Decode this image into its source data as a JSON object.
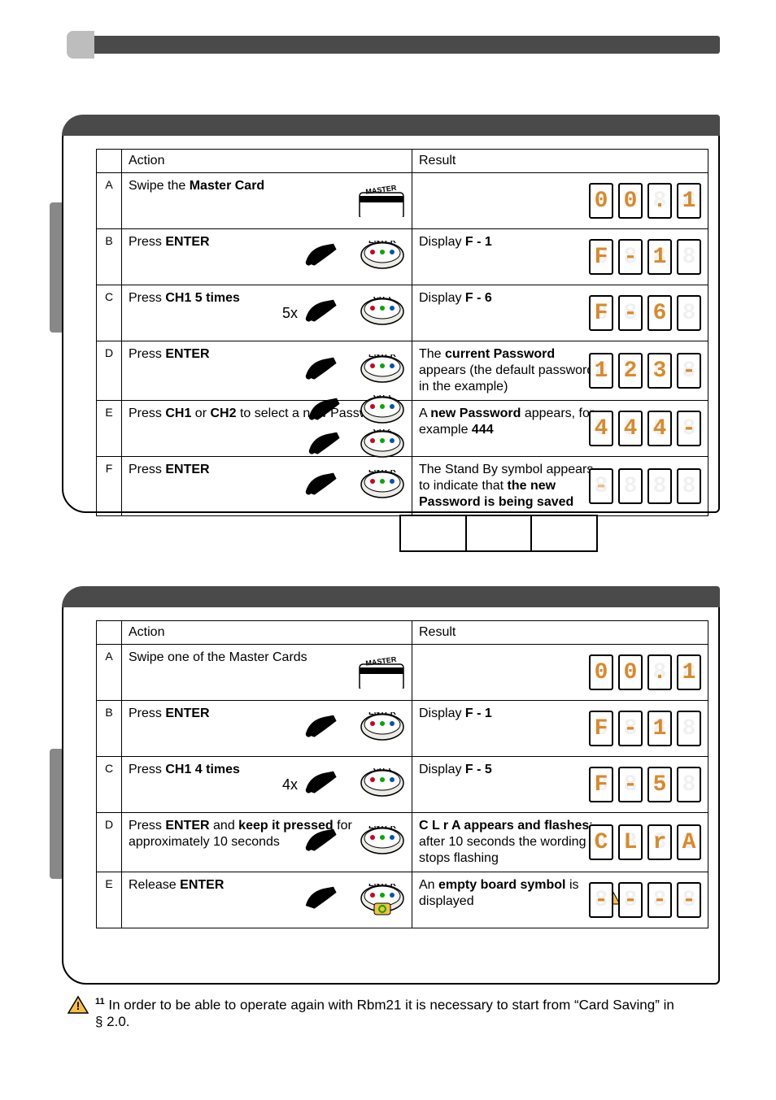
{
  "sections": [
    {
      "id": "change_password",
      "headers": {
        "action": "Action",
        "result": "Result"
      },
      "rows": [
        {
          "idx": "A",
          "action": "Swipe the <b>Master Card</b>",
          "icon_set": [
            "master-card-icon"
          ],
          "result": "",
          "lcd": {
            "style": "orange",
            "chars": [
              "0",
              "0",
              ".",
              "1"
            ]
          }
        },
        {
          "idx": "B",
          "action": "Press <b>ENTER</b>",
          "icon_set": [
            "hand-press-icon",
            "enter-key-icon"
          ],
          "result": "Display <b>F - 1</b>",
          "lcd": {
            "style": "orange",
            "chars": [
              "F",
              "-",
              "1",
              " "
            ]
          }
        },
        {
          "idx": "C",
          "action": "Press <b>CH1 5 times</b>",
          "prefix": "5x",
          "icon_set": [
            "hand-press-icon",
            "ch1-key-icon"
          ],
          "result": "Display <b>F - 6</b>",
          "lcd": {
            "style": "orange",
            "chars": [
              "F",
              "-",
              "6",
              " "
            ]
          }
        },
        {
          "idx": "D",
          "action": "Press <b>ENTER</b>",
          "icon_set": [
            "hand-press-icon",
            "enter-key-icon"
          ],
          "result": "The <b>current Password</b> appears (the default password in the example)",
          "lcd": {
            "style": "orange",
            "chars": [
              "1",
              "2",
              "3",
              "-"
            ]
          }
        },
        {
          "idx": "E",
          "action": "Press <b>CH1</b> or <b>CH2</b> to select a new Password",
          "icon_set": [
            "hand-press-icon",
            "ch1-key-icon",
            "hand-press-icon",
            "ch2-key-icon"
          ],
          "result": "A <b>new Password</b> appears, for example <b>444</b>",
          "lcd": {
            "style": "orange",
            "chars": [
              "4",
              "4",
              "4",
              "-"
            ]
          }
        },
        {
          "idx": "F",
          "action": "Press <b>ENTER</b>",
          "icon_set": [
            "hand-press-icon",
            "enter-key-icon"
          ],
          "result": "The Stand By symbol appears to indicate that <b>the new Password is being saved</b>",
          "lcd": {
            "style": "faint",
            "chars": [
              "-",
              " ",
              " ",
              " "
            ]
          }
        }
      ]
    },
    {
      "id": "full_deletion",
      "headers": {
        "action": "Action",
        "result": "Result"
      },
      "rows": [
        {
          "idx": "A",
          "action": "Swipe one of the Master Cards",
          "icon_set": [
            "master-card-icon"
          ],
          "result": "",
          "lcd": {
            "style": "orange",
            "chars": [
              "0",
              "0",
              ".",
              "1"
            ]
          }
        },
        {
          "idx": "B",
          "action": "Press <b>ENTER</b>",
          "icon_set": [
            "hand-press-icon",
            "enter-key-icon"
          ],
          "result": "Display <b>F - 1</b>",
          "lcd": {
            "style": "orange",
            "chars": [
              "F",
              "-",
              "1",
              " "
            ]
          }
        },
        {
          "idx": "C",
          "action": "Press <b>CH1 4 times</b>",
          "prefix": "4x",
          "icon_set": [
            "hand-press-icon",
            "ch1-key-icon"
          ],
          "result": "Display <b>F - 5</b>",
          "lcd": {
            "style": "orange",
            "chars": [
              "F",
              "-",
              "5",
              " "
            ]
          }
        },
        {
          "idx": "D",
          "action": "Press <b>ENTER</b> and <b>keep it pressed</b> for approximately 10 seconds",
          "icon_set": [
            "hand-press-icon",
            "enter-key-icon"
          ],
          "result": "<b>C L r A appears and flashes</b>; after 10 seconds the wording stops flashing",
          "lcd": {
            "style": "orange",
            "chars": [
              "C",
              "L",
              "r",
              "A"
            ],
            "flash": true
          }
        },
        {
          "idx": "E",
          "action": "Release <b>ENTER</b>",
          "icon_set": [
            "hand-release-icon",
            "enter-key-icon-yellow"
          ],
          "result": "An <b>empty board symbol</b> is displayed",
          "result_warn": "11",
          "lcd": {
            "style": "orange",
            "chars": [
              "-",
              "-",
              "-",
              "-"
            ]
          }
        }
      ]
    }
  ],
  "footnote": {
    "num": "11",
    "text": "In order to be able to operate again with Rbm21 it is necessary to start from “Card Saving” in § 2.0."
  }
}
